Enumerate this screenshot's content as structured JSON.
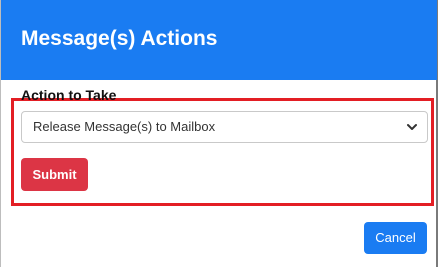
{
  "dialog": {
    "title": "Message(s) Actions"
  },
  "form": {
    "action_label": "Action to Take",
    "action_select": {
      "value": "Release Message(s) to Mailbox",
      "icon": "chevron-down-icon"
    },
    "submit_label": "Submit"
  },
  "footer": {
    "cancel_label": "Cancel"
  },
  "colors": {
    "header": "#1a7cf2",
    "primary": "#1a7cf2",
    "danger": "#dc3545",
    "highlight": "#e31e24"
  }
}
